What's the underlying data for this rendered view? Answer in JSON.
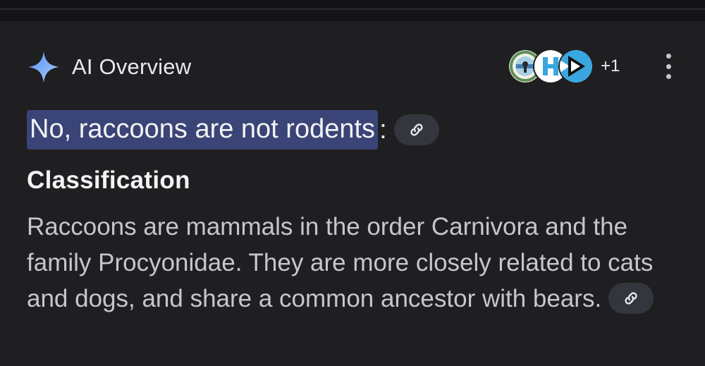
{
  "header": {
    "title": "AI Overview",
    "icon": "sparkle-icon",
    "sources_more": "+1"
  },
  "answer": {
    "highlight": "No, raccoons are not rodents",
    "suffix": ":",
    "link_icon": "link-icon"
  },
  "section": {
    "title": "Classification",
    "body": "Raccoons are mammals in the order Carnivora and the family Procyonidae. They are more closely related to cats and dogs, and share a common ancestor with bears."
  },
  "colors": {
    "background": "#1f1f21",
    "highlight": "#3a4477",
    "chip": "#33363c",
    "text": "#c4c7cc"
  }
}
